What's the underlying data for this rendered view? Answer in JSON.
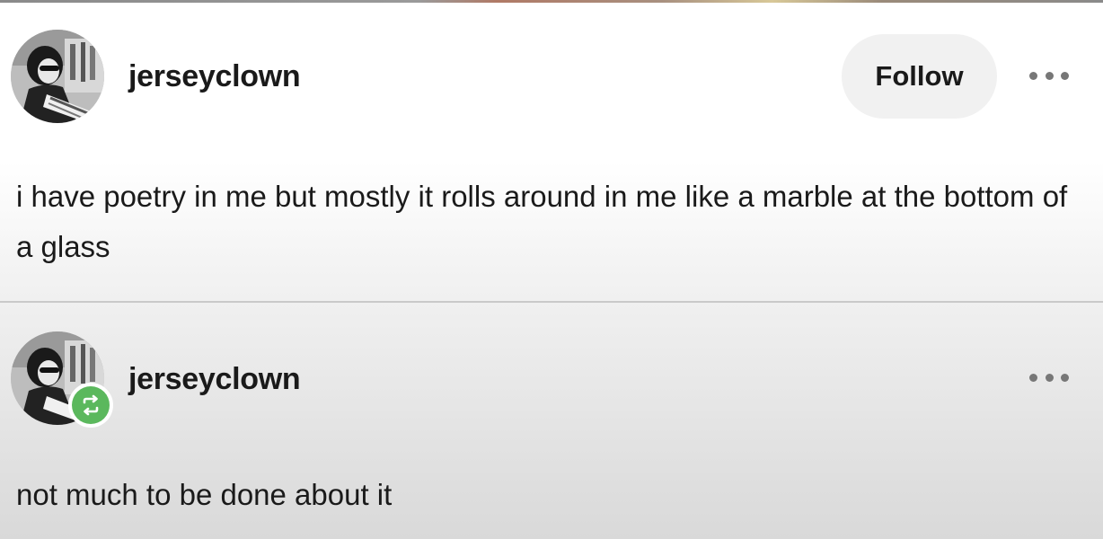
{
  "posts": [
    {
      "username": "jerseyclown",
      "follow_label": "Follow",
      "body": "i have poetry in me but mostly it rolls around in me like a marble at the bottom of a glass",
      "avatar": "user-photo",
      "more_icon": "ellipsis-icon"
    },
    {
      "username": "jerseyclown",
      "body": "not much to be done about it",
      "avatar": "user-photo",
      "badge_icon": "reblog-icon",
      "more_icon": "ellipsis-icon"
    }
  ],
  "colors": {
    "reblog_badge": "#5bb85d",
    "follow_button_bg": "#f1f1f1",
    "text": "#1a1a1a"
  }
}
